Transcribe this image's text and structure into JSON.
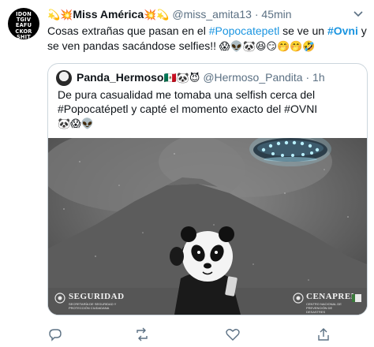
{
  "tweet": {
    "avatar_text": "IDON\nTGIV\nEAFU\nCKOR\nSHIT",
    "name_prefix_emoji": "💫💥",
    "display_name": "Miss América",
    "name_suffix_emoji": "💥💫",
    "handle": "@miss_amita13",
    "separator": "·",
    "time": "45min",
    "text_1": "Cosas extrañas que pasan en el ",
    "hashtag_1": "#Popocatepetl",
    "text_2": " se ve un ",
    "hashtag_2": "#Ovni",
    "text_3": " y se ven pandas sacándose selfies!! ",
    "text_emojis": "😱👽🐼😆😏🤭🤭🤣"
  },
  "quoted": {
    "display_name": "Panda_Hermoso",
    "name_emojis": "🇲🇽🐼😈",
    "handle": "@Hermoso_Pandita",
    "separator": "·",
    "time": "1h",
    "text": "De pura casualidad me tomaba una selfish cerca del #Popocatépetl y capté el momento exacto del #OVNI",
    "text_emojis": "🐼😱👽",
    "media_logo_left": "SEGURIDAD",
    "media_logo_left_sub": "SECRETARÍA DE SEGURIDAD Y PROTECCIÓN CIUDADANA",
    "media_logo_right": "CENAPRED",
    "media_logo_right_sub": "CENTRO NACIONAL DE PREVENCIÓN DE DESASTRES"
  },
  "actions": [
    "reply-icon",
    "retweet-icon",
    "like-icon",
    "share-icon"
  ],
  "colors": {
    "link": "#1b95e0",
    "secondary_text": "#5b7083",
    "border": "#ccd6dd",
    "ufo_glow": "#9fdcef"
  }
}
